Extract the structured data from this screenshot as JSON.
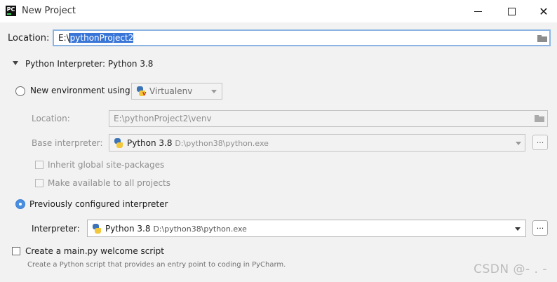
{
  "window": {
    "title": "New Project",
    "app_icon_text": "PC",
    "close_glyph": "✕"
  },
  "location": {
    "label": "Location:",
    "prefix": "E:\\",
    "selected": "pythonProject2",
    "folder_icon": "folder-icon"
  },
  "interpreter_section": {
    "title": "Python Interpreter: Python 3.8",
    "expanded": true
  },
  "new_env": {
    "radio_label": "New environment using",
    "selected": false,
    "tool": "Virtualenv",
    "location_label": "Location:",
    "location_value": "E:\\pythonProject2\\venv",
    "base_label": "Base interpreter:",
    "base_name": "Python 3.8",
    "base_path": "D:\\python38\\python.exe",
    "browse": "...",
    "inherit_label": "Inherit global site-packages",
    "make_available_label": "Make available to all projects"
  },
  "previous": {
    "radio_label": "Previously configured interpreter",
    "selected": true,
    "interpreter_label": "Interpreter:",
    "interpreter_name": "Python 3.8",
    "interpreter_path": "D:\\python38\\python.exe",
    "browse": "..."
  },
  "welcome": {
    "checkbox_label": "Create a main.py welcome script",
    "checked": false,
    "description": "Create a Python script that provides an entry point to coding in PyCharm."
  },
  "watermark": "CSDN @- . -",
  "colors": {
    "selection": "#3875d7",
    "focus_border": "#8cb4e2",
    "radio_accent": "#3d7fd8",
    "background": "#f2f2f2"
  }
}
